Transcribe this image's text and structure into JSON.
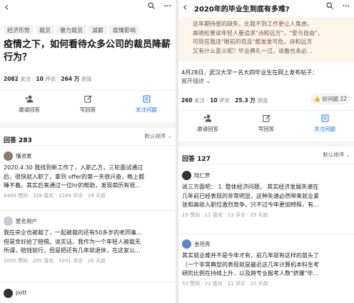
{
  "left": {
    "back_icon": "‹",
    "tags": [
      "经济形势",
      "裁员",
      "暴力裁员",
      "减薪",
      "疫情影响"
    ],
    "question_title": "疫情之下，如何看待众多公司的裁员降薪行为？",
    "stats": {
      "follow_num": "2082",
      "follow_label": "关注",
      "comment_num": "10",
      "comment_label": "评论",
      "views_num": "264 万",
      "views_label": "浏览"
    },
    "actions": [
      {
        "icon": "person-plus-icon",
        "glyph": "⁺👤",
        "label": "邀请回答"
      },
      {
        "icon": "edit-icon",
        "glyph": "✎",
        "label": "写回答"
      },
      {
        "icon": "follow-icon",
        "glyph": "☰",
        "label": "关注问题"
      }
    ],
    "answers_header": {
      "label": "回答 283",
      "sort": "默认排序 ⌄"
    },
    "answers": [
      {
        "author": "懂退果",
        "lines": [
          "2020.4.30 我找到新工作了，入职乙方，三轮面试通过",
          "后，很快就入职了。拿到 offer的第一天很兴奋，晚上都",
          "睡不着。其实后来通过一位hr的帮助，发现简历有很..."
        ],
        "meta": "4489 赞同 · 328 喜欢 · 1289 评论 · 19 天前"
      },
      {
        "author": "匿名用户",
        "lines": [
          "我在央企也被裁了，一起被裁的还有50多岁的老同事...",
          "但是幸好给了赔偿。说实话，我作为一个年轻人被裁无",
          "所谓，赔钱就行，但是把还有几年就退休，在这家公..."
        ],
        "meta": "2000 赞同 · 205 喜欢 · 1031 评论 · 26 天前"
      },
      {
        "author": "pott",
        "lines": [],
        "meta": ""
      }
    ]
  },
  "right": {
    "back_icon": "‹",
    "title": "2020年的毕业生到底有多难?",
    "quote_lines": [
      "这年期待感的缺失，比我不到工作更让人焦虑。",
      "高晓松曾说年轻人要追求\"诗和远方\"，\"爱与自由\"，",
      "可现在我连\"眼前的苟且\"都发发可危，诗和远方",
      "又有什么意义呢？毕业典礼一过，说着也未必..."
    ],
    "description": "4月28日，武汉大学一名大四毕业生在网上发布帖子：",
    "expand": "展开描述 ⌄",
    "stats": {
      "follow_num": "260",
      "follow_label": "关注",
      "comment_num": "10",
      "comment_label": "评论",
      "views_num": "25.3 万",
      "views_label": "浏览"
    },
    "good_question": "👍 好问题 22",
    "actions": [
      {
        "icon": "person-plus-icon",
        "glyph": "⁺👤",
        "label": "邀请回答"
      },
      {
        "icon": "edit-icon",
        "glyph": "✎",
        "label": "写回答"
      },
      {
        "icon": "follow-icon",
        "glyph": "☰",
        "label": "关注问题"
      }
    ],
    "answers_header": {
      "label": "回答 127",
      "sort": "默认排序 ⌄"
    },
    "answers": [
      {
        "author": "陆仁贾",
        "lines": [
          "说三方面吧： 1. 整体经济问题， 其实经济发展失速在",
          "几年前已经表现的非常明显，这种失速必然带来就业紧",
          "张和高收入职位激烈竞争，只不过今年更加特殊，有..."
        ],
        "meta": "19 赞同 · 11 喜欢 · 13 评论 · 25 天前"
      },
      {
        "author": "金坦亮",
        "lines": [
          "其实就业难并不是今年才有，前几年就有这样的苗头了",
          "（一个非常典型的表现就是最近这几年计算机本科生考",
          "研的比例在持续上升，以及跨专业报考人数\"挤爆\"毕..."
        ],
        "meta": "53 赞同 · 21 喜欢 · 21 评论 · 20 天前"
      }
    ]
  }
}
